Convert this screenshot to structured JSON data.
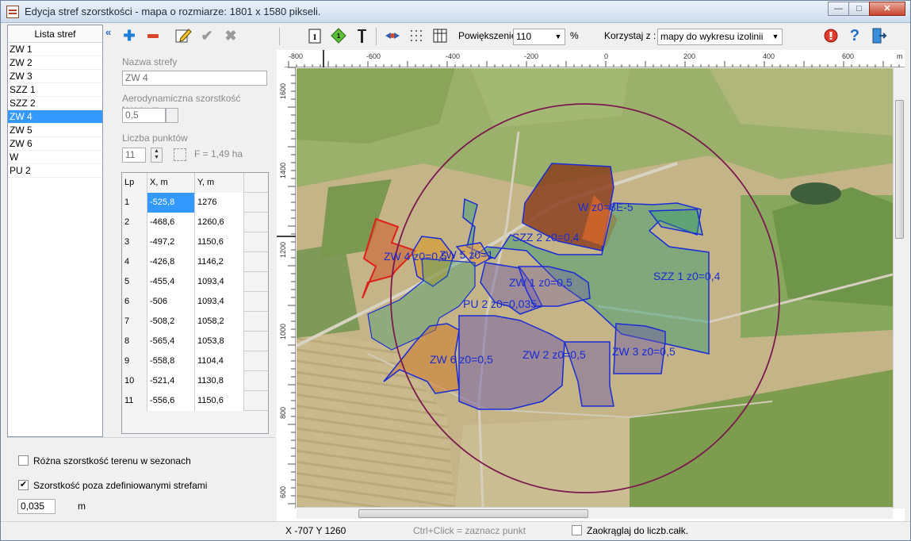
{
  "window": {
    "title": "Edycja stref szorstkości   - mapa o rozmiarze: 1801 x 1580 pikseli.",
    "controls": {
      "minimize": "—",
      "maximize": "□",
      "close": "✕"
    }
  },
  "zone_list": {
    "header": "Lista stref",
    "collapse_glyph": "«",
    "items": [
      "ZW 1",
      "ZW 2",
      "ZW 3",
      "SZZ 1",
      "SZZ 2",
      "ZW 4",
      "ZW 5",
      "ZW 6",
      "W",
      "PU 2"
    ],
    "selected_index": 5
  },
  "toolbar": {
    "zoom_label": "Powiększenie :",
    "zoom_value": "110",
    "zoom_unit": "%",
    "use_label": "Korzystaj z :",
    "use_value": "mapy do wykresu izolinii"
  },
  "form": {
    "name_label": "Nazwa strefy",
    "name_value": "ZW 4",
    "roughness_label": "Aerodynamiczna szorstkość terenu,m",
    "roughness_value": "0,5",
    "points_label": "Liczba punktów",
    "points_value": "11",
    "area_text": "F  =  1,49 ha",
    "table": {
      "headers": [
        "Lp",
        "X, m",
        "Y, m"
      ],
      "rows": [
        [
          "1",
          "-525,8",
          "1276"
        ],
        [
          "2",
          "-468,6",
          "1260,6"
        ],
        [
          "3",
          "-497,2",
          "1150,6"
        ],
        [
          "4",
          "-426,8",
          "1146,2"
        ],
        [
          "5",
          "-455,4",
          "1093,4"
        ],
        [
          "6",
          "-506",
          "1093,4"
        ],
        [
          "7",
          "-508,2",
          "1058,2"
        ],
        [
          "8",
          "-565,4",
          "1053,8"
        ],
        [
          "9",
          "-558,8",
          "1104,4"
        ],
        [
          "10",
          "-521,4",
          "1130,8"
        ],
        [
          "11",
          "-556,6",
          "1150,6"
        ]
      ]
    }
  },
  "options": {
    "seasonal_label": "Różna szorstkość terenu w sezonach",
    "seasonal_checked": false,
    "outside_label": "Szorstkość poza zdefiniowanymi strefami",
    "outside_checked": true,
    "outside_value": "0,035",
    "outside_unit": "m"
  },
  "map": {
    "ruler_top": [
      "-800",
      "-600",
      "-400",
      "-200",
      "0",
      "200",
      "400",
      "600",
      "m"
    ],
    "ruler_left": [
      "1600",
      "1400",
      "1200",
      "1000",
      "800",
      "600"
    ],
    "zone_labels": [
      "W z0=8E-5",
      "SZZ 2 z0=0,4",
      "ZW 4 z0=0,5",
      "ZW 5  z0=1",
      "ZW 1 z0=0,5",
      "SZZ 1 z0=0,4",
      "PU 2 z0=0,035",
      "ZW 6 z0=0,5",
      "ZW 2 z0=0,5",
      "ZW 3 z0=0,5"
    ],
    "colors": {
      "zone_blue": "#1a2cd6",
      "zone_red": "#e0201a",
      "circle": "#7a1a4e",
      "brown_fill": "#8a3a1a",
      "orange_fill": "#d87a2a",
      "green_fill": "#2f9a6e",
      "purple_fill": "#6f5aa8"
    }
  },
  "status": {
    "coords": "X -707 Y 1260",
    "hint": "Ctrl+Click = zaznacz punkt",
    "round_label": "Zaokrąglaj do liczb.całk."
  }
}
